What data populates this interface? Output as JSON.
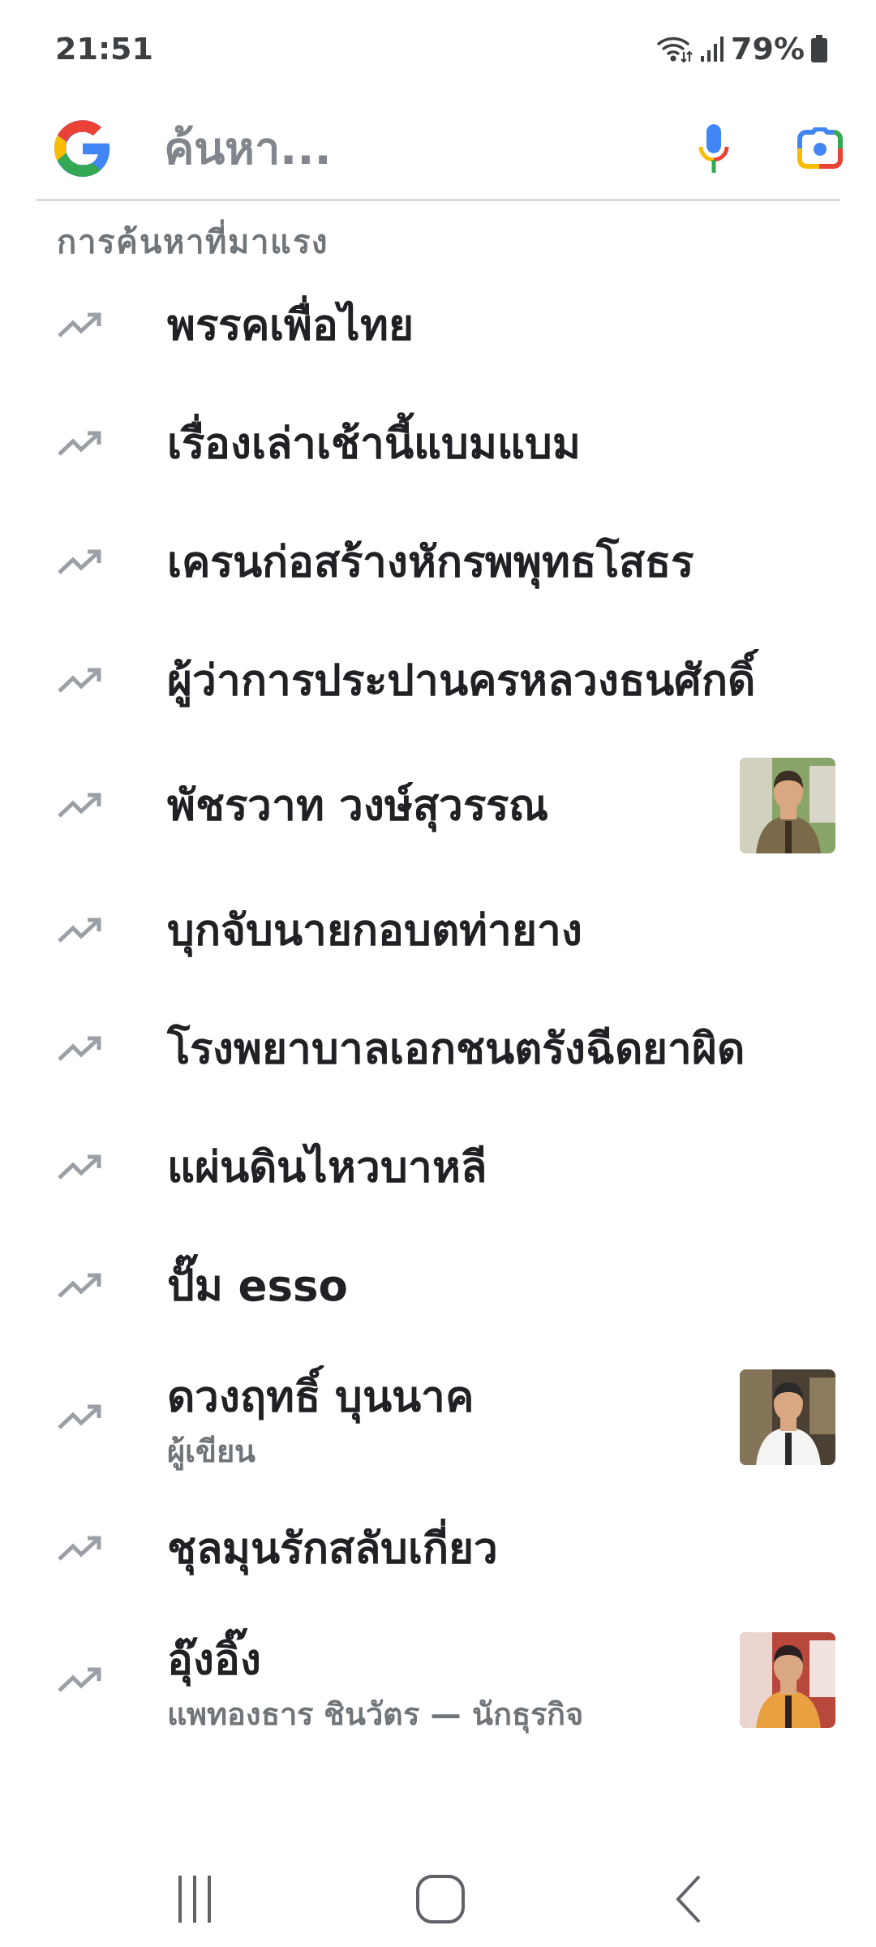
{
  "status_bar": {
    "time": "21:51",
    "battery": "79%"
  },
  "search": {
    "placeholder": "ค้นหา..."
  },
  "section_title": "การค้นหาที่มาแรง",
  "trends": [
    {
      "title": "พรรคเพื่อไทย"
    },
    {
      "title": "เรื่องเล่าเช้านี้แบมแบม"
    },
    {
      "title": "เครนก่อสร้างหักรพพุทธโสธร"
    },
    {
      "title": "ผู้ว่าการประปานครหลวงธนศักดิ์"
    },
    {
      "title": "พัชรวาท วงษ์สุวรรณ"
    },
    {
      "title": "บุกจับนายกอบตท่ายาง"
    },
    {
      "title": "โรงพยาบาลเอกชนตรังฉีดยาผิด"
    },
    {
      "title": "แผ่นดินไหวบาหลี"
    },
    {
      "title": "ปั๊ม esso"
    },
    {
      "title": "ดวงฤทธิ์ บุนนาค",
      "subtitle": "ผู้เขียน"
    },
    {
      "title": "ชุลมุนรักสลับเกี่ยว"
    },
    {
      "title": "อุ๊งอิ๊ง",
      "subtitle": "แพทองธาร ชินวัตร — นักธุรกิจ"
    }
  ]
}
